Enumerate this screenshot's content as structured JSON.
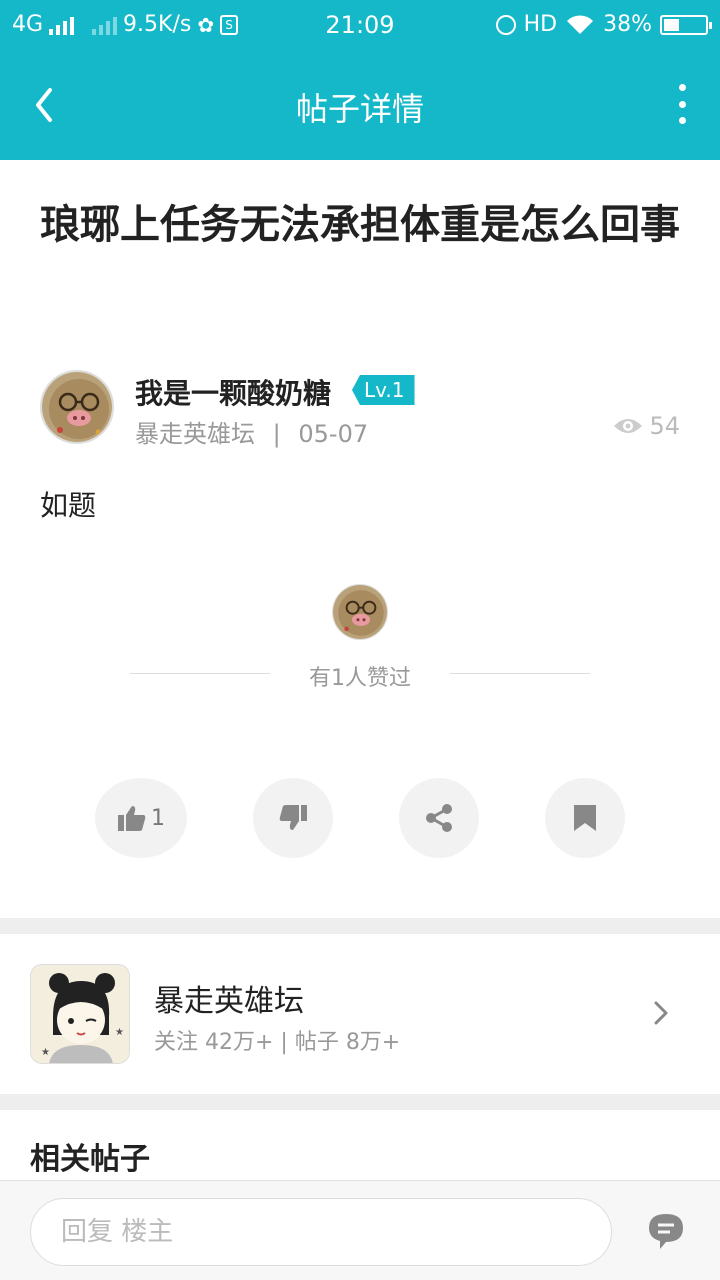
{
  "status_bar": {
    "network": "4G",
    "speed": "9.5K/s",
    "time": "21:09",
    "hd": "HD",
    "battery": "38%",
    "battery_level": 0.38
  },
  "header": {
    "title": "帖子详情"
  },
  "post": {
    "title": "琅琊上任务无法承担体重是怎么回事",
    "author": {
      "name": "我是一颗酸奶糖",
      "level": "Lv.1",
      "forum": "暴走英雄坛",
      "separator": "|",
      "date": "05-07"
    },
    "views": "54",
    "body": "如题",
    "likes_text": "有1人赞过"
  },
  "actions": {
    "like_count": "1"
  },
  "forum_card": {
    "name": "暴走英雄坛",
    "meta": "关注 42万+  |  帖子 8万+"
  },
  "related": {
    "title": "相关帖子"
  },
  "reply": {
    "placeholder": "回复  楼主"
  },
  "colors": {
    "accent": "#14b8c9",
    "divider": "#eeeeee",
    "muted_text": "#999999"
  }
}
